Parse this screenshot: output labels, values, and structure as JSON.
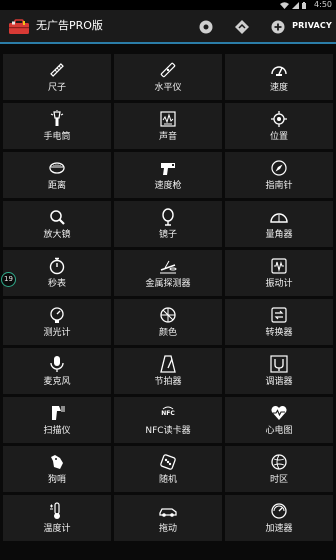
{
  "status_bar": {
    "time": "4:50"
  },
  "action_bar": {
    "title": "无广告PRO版",
    "privacy_label": "PRIVACY"
  },
  "side_badge": "19",
  "tools": [
    {
      "label": "尺子",
      "icon": "ruler-icon"
    },
    {
      "label": "水平仪",
      "icon": "level-icon"
    },
    {
      "label": "速度",
      "icon": "speedometer-icon"
    },
    {
      "label": "手电筒",
      "icon": "flashlight-icon"
    },
    {
      "label": "声音",
      "icon": "sound-meter-icon"
    },
    {
      "label": "位置",
      "icon": "location-icon"
    },
    {
      "label": "距离",
      "icon": "distance-icon"
    },
    {
      "label": "速度枪",
      "icon": "speed-gun-icon"
    },
    {
      "label": "指南针",
      "icon": "compass-icon"
    },
    {
      "label": "放大镜",
      "icon": "magnifier-icon"
    },
    {
      "label": "镜子",
      "icon": "mirror-icon"
    },
    {
      "label": "量角器",
      "icon": "protractor-icon"
    },
    {
      "label": "秒表",
      "icon": "stopwatch-icon"
    },
    {
      "label": "金属探测器",
      "icon": "metal-detector-icon"
    },
    {
      "label": "振动计",
      "icon": "vibrometer-icon"
    },
    {
      "label": "测光计",
      "icon": "light-meter-icon"
    },
    {
      "label": "颜色",
      "icon": "color-icon"
    },
    {
      "label": "转换器",
      "icon": "converter-icon"
    },
    {
      "label": "麦克风",
      "icon": "microphone-icon"
    },
    {
      "label": "节拍器",
      "icon": "metronome-icon"
    },
    {
      "label": "调谐器",
      "icon": "tuner-icon"
    },
    {
      "label": "扫描仪",
      "icon": "scanner-icon"
    },
    {
      "label": "NFC读卡器",
      "icon": "nfc-icon"
    },
    {
      "label": "心电图",
      "icon": "heart-rate-icon"
    },
    {
      "label": "狗哨",
      "icon": "dog-whistle-icon"
    },
    {
      "label": "随机",
      "icon": "dice-icon"
    },
    {
      "label": "时区",
      "icon": "time-zone-icon"
    },
    {
      "label": "温度计",
      "icon": "thermometer-icon"
    },
    {
      "label": "拖动",
      "icon": "car-icon"
    },
    {
      "label": "加速器",
      "icon": "accelerometer-icon"
    }
  ]
}
